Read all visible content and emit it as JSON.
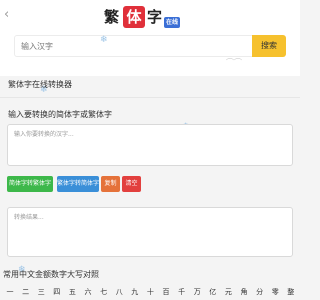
{
  "header": {
    "back_icon": "chevron-left-icon",
    "logo": [
      "繁",
      "体",
      "字",
      "在线"
    ],
    "search": {
      "placeholder": "输入汉字",
      "value": "",
      "button_label": "搜索"
    }
  },
  "decorations": [
    "snowflake-icon",
    "snowflake-icon",
    "snowflake-icon",
    "snowflake-icon"
  ],
  "tool": {
    "section_title": "繁体字在线转换器",
    "input_label": "输入要转换的简体字或繁体字",
    "input_placeholder": "输入你要转换的汉字...",
    "input_value": "",
    "buttons": {
      "to_traditional": "简体字转繁体字",
      "to_simplified": "繁体字转简体字",
      "copy": "复制",
      "clear": "清空"
    },
    "output_placeholder": "转换结果...",
    "output_value": ""
  },
  "numerals": {
    "title": "常用中文金额数字大写对照",
    "row": [
      "一",
      "二",
      "三",
      "四",
      "五",
      "六",
      "七",
      "八",
      "九",
      "十",
      "百",
      "千",
      "万",
      "亿",
      "元",
      "角",
      "分",
      "零",
      "整"
    ]
  },
  "colors": {
    "logo_accent": "#e0303a",
    "logo_badge": "#3b6fd6",
    "search_button": "#f6c12e",
    "convert_button": "#3db84a",
    "reverse_button": "#3a8fd8",
    "copy_button": "#e5723a",
    "clear_button": "#e2403e"
  }
}
